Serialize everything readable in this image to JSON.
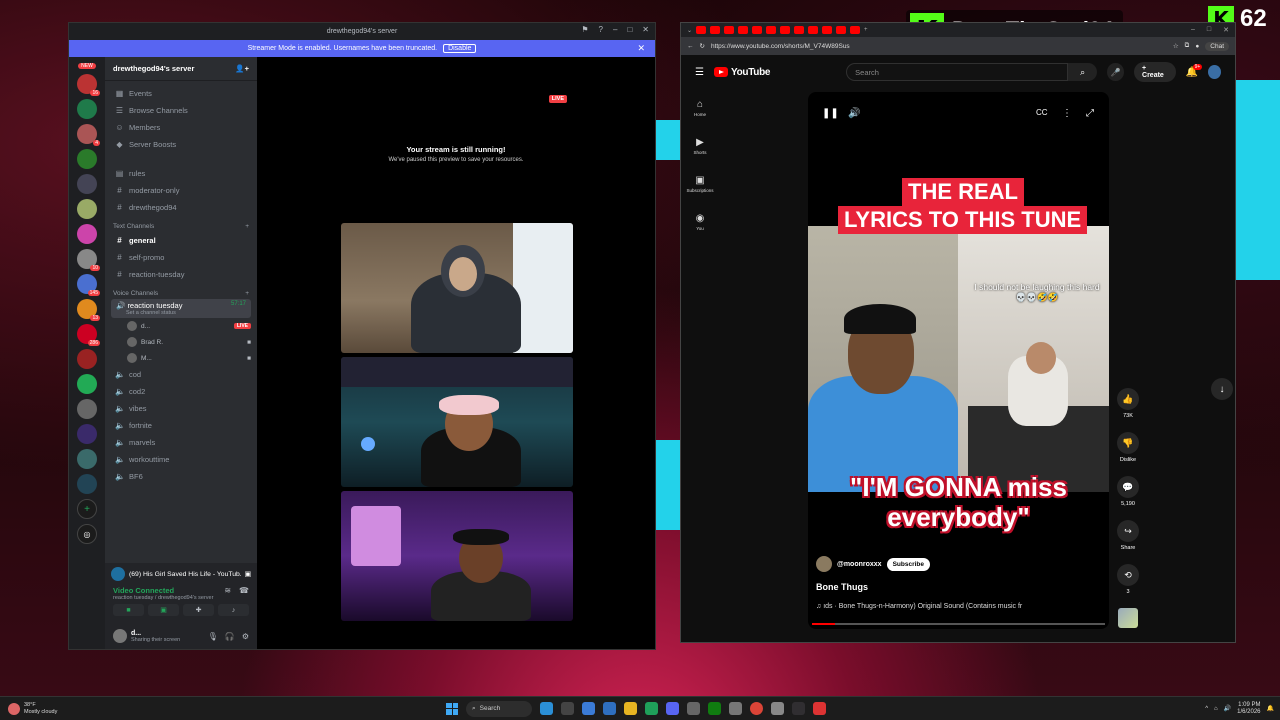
{
  "overlay": {
    "streamer_name": "DrewTheGod94",
    "viewer_count": "62",
    "kick_logo": "K"
  },
  "discord": {
    "window_title": "drewthegod94's server",
    "banner_text": "Streamer Mode is enabled. Usernames have been truncated.",
    "banner_button": "Disable",
    "new_badge": "NEW",
    "guild_badges": [
      "16",
      "4",
      "10",
      "145",
      "13",
      "286"
    ],
    "server_name": "drewthegod94's server",
    "top_items": [
      {
        "icon": "calendar-icon",
        "label": "Events"
      },
      {
        "icon": "browse-icon",
        "label": "Browse Channels"
      },
      {
        "icon": "members-icon",
        "label": "Members"
      },
      {
        "icon": "boost-icon",
        "label": "Server Boosts"
      }
    ],
    "channels_a": [
      "rules",
      "moderator-only",
      "drewthegod94"
    ],
    "text_category": "Text Channels",
    "text_channels": [
      "general",
      "self-promo",
      "reaction-tuesday"
    ],
    "voice_category": "Voice Channels",
    "active_voice": {
      "name": "reaction tuesday",
      "timer": "57:17",
      "status": "Set a channel status"
    },
    "voice_users": [
      {
        "name": "d...",
        "live": "LIVE"
      },
      {
        "name": "Brad R.",
        "live": ""
      },
      {
        "name": "M...",
        "live": ""
      }
    ],
    "voice_channels": [
      "cod",
      "cod2",
      "vibes",
      "fortnite",
      "marvels",
      "workouttime",
      "BF6"
    ],
    "activity": "(69) His Girl Saved His Life - YouTub...",
    "voice_connected": "Video Connected",
    "voice_sub": "reaction tuesday / drewthegod94's server",
    "user_name": "d...",
    "user_status": "Sharing their screen",
    "stream_live": "LIVE",
    "paused_title": "Your stream is still running!",
    "paused_sub": "We've paused this preview to save your resources."
  },
  "browser": {
    "url": "https://www.youtube.com/shorts/M_V74W89Sus",
    "chat_label": "Chat",
    "yt_logo": "YouTube",
    "search_placeholder": "Search",
    "create_label": "Create",
    "notif_badge": "9+",
    "side": [
      {
        "icon": "home-icon",
        "label": "Home"
      },
      {
        "icon": "shorts-icon",
        "label": "Shorts"
      },
      {
        "icon": "subscriptions-icon",
        "label": "Subscriptions"
      },
      {
        "icon": "you-icon",
        "label": "You"
      }
    ],
    "caption_top_1": "THE REAL",
    "caption_top_2": "LYRICS TO THIS TUNE",
    "side_caption": "I should  not be laughing this hard 💀💀🤣🤣",
    "big_caption": "\"I'M GONNA miss everybody\"",
    "channel": "@moonroxxx",
    "subscribe": "Subscribe",
    "title": "Bone Thugs",
    "music": "♫ ıds · Bone Thugs-n-Harmony)   Original Sound (Contains music fr",
    "progress": 0.08,
    "actions": [
      {
        "icon": "like-icon",
        "label": "73K"
      },
      {
        "icon": "dislike-icon",
        "label": "Dislike"
      },
      {
        "icon": "comment-icon",
        "label": "5,190"
      },
      {
        "icon": "share-icon",
        "label": "Share"
      },
      {
        "icon": "remix-icon",
        "label": "3"
      }
    ]
  },
  "taskbar": {
    "temp": "38°F",
    "weather": "Mostly cloudy",
    "search": "Search",
    "time": "1:09 PM",
    "date": "1/6/2026"
  }
}
